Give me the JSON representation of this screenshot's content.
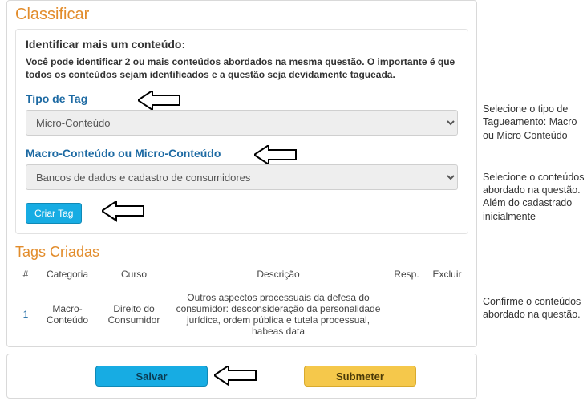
{
  "classifyTitle": "Classificar",
  "identTitle": "Identificar mais um conteúdo:",
  "identDesc": "Você pode identificar 2 ou mais conteúdos abordados na mesma questão. O importante é que todos os conteúdos sejam identificados e a questão seja devidamente tagueada.",
  "tagTypeLabel": "Tipo de Tag",
  "tagTypeValue": "Micro-Conteúdo",
  "contentLabel": "Macro-Conteúdo ou Micro-Conteúdo",
  "contentValue": "Bancos de dados e cadastro de consumidores",
  "criarTag": "Criar Tag",
  "tagsCreated": "Tags Criadas",
  "col": {
    "hash": "#",
    "categoria": "Categoria",
    "curso": "Curso",
    "descricao": "Descrição",
    "resp": "Resp.",
    "excluir": "Excluir"
  },
  "row1": {
    "idx": "1",
    "categoria": "Macro-Conteúdo",
    "curso": "Direito do Consumidor",
    "descricao": "Outros aspectos processuais da defesa do consumidor: desconsideração da personalidade jurídica, ordem pública e tutela processual, habeas data"
  },
  "salvar": "Salvar",
  "submeter": "Submeter",
  "note1": "Selecione o tipo de Tagueamento: Macro ou Micro Conteúdo",
  "note2": "Selecione o conteúdos abordado na questão. Além do cadastrado inicialmente",
  "note3": "Confirme o conteúdos abordado na questão."
}
